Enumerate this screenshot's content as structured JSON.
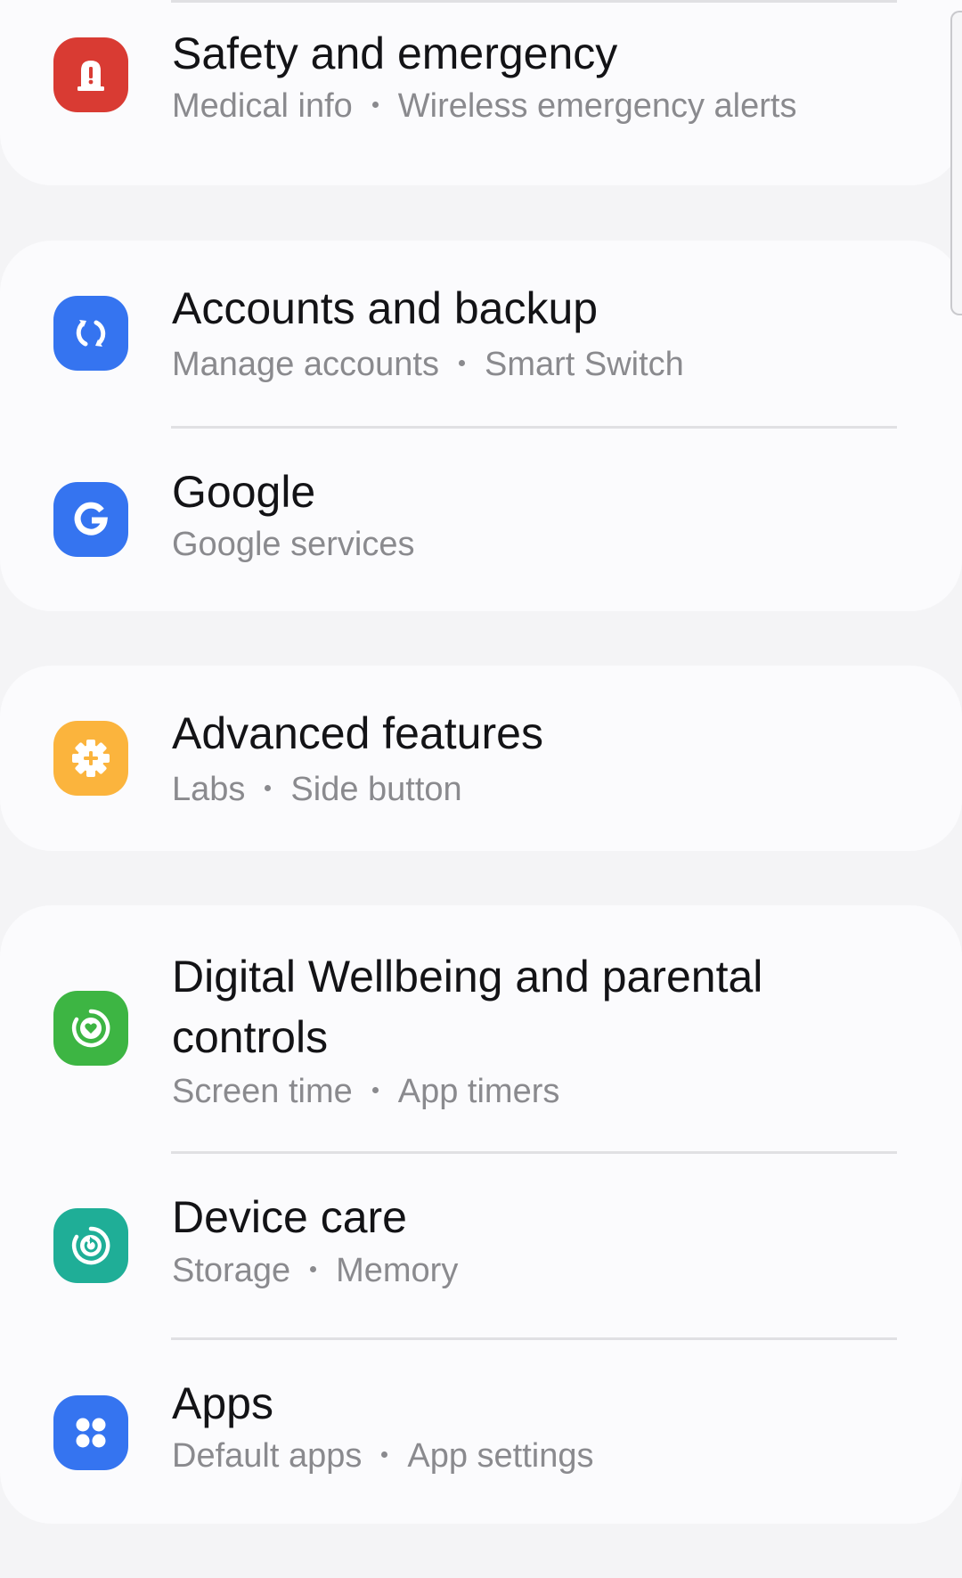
{
  "colors": {
    "safety": "#d93b33",
    "accounts": "#3574f0",
    "google": "#3574f0",
    "advanced": "#fbb43d",
    "wellbeing": "#3db543",
    "device_care": "#1fae97",
    "apps": "#3574f0"
  },
  "settings": {
    "safety": {
      "icon": "emergency-siren-icon",
      "title": "Safety and emergency",
      "sub": [
        "Medical info",
        "Wireless emergency alerts"
      ]
    },
    "accounts": {
      "icon": "sync-icon",
      "title": "Accounts and backup",
      "sub": [
        "Manage accounts",
        "Smart Switch"
      ]
    },
    "google": {
      "icon": "google-g-icon",
      "title": "Google",
      "sub": [
        "Google services"
      ]
    },
    "advanced": {
      "icon": "gear-plus-icon",
      "title": "Advanced features",
      "sub": [
        "Labs",
        "Side button"
      ]
    },
    "wellbeing": {
      "icon": "heart-circle-icon",
      "title": "Digital Wellbeing and parental controls",
      "sub": [
        "Screen time",
        "App timers"
      ]
    },
    "device_care": {
      "icon": "device-care-icon",
      "title": "Device care",
      "sub": [
        "Storage",
        "Memory"
      ]
    },
    "apps": {
      "icon": "apps-grid-icon",
      "title": "Apps",
      "sub": [
        "Default apps",
        "App settings"
      ]
    }
  }
}
